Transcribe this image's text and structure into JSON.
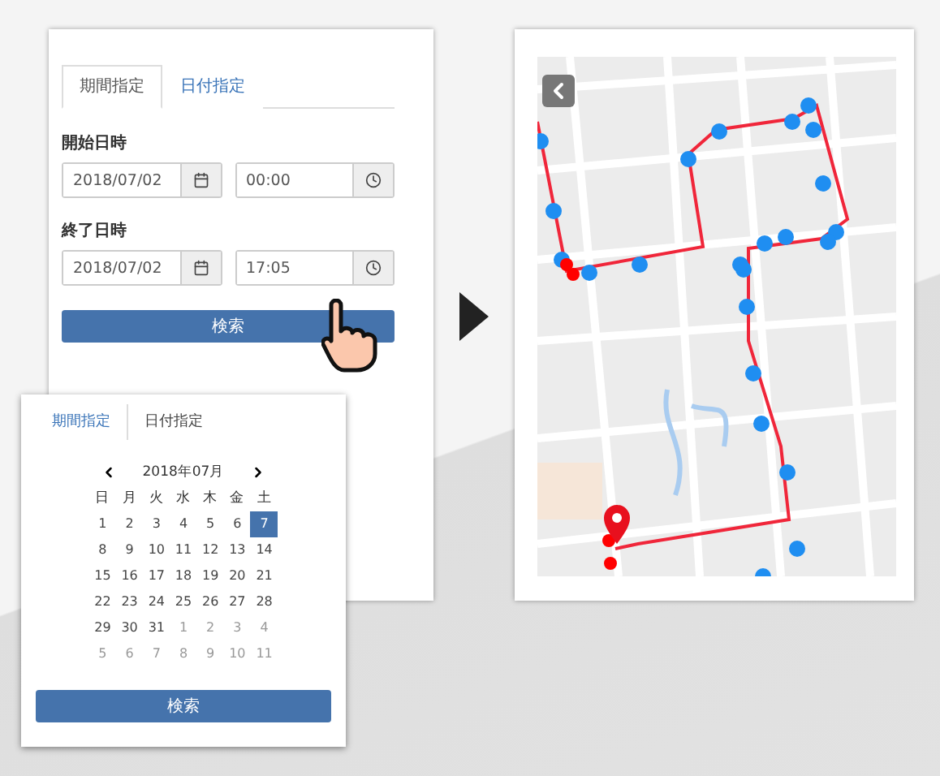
{
  "search_panel": {
    "tabs": [
      {
        "label": "期間指定",
        "selected": true
      },
      {
        "label": "日付指定",
        "selected": false
      }
    ],
    "fields": [
      {
        "label": "開始日時",
        "date": "2018/07/02",
        "time": "00:00"
      },
      {
        "label": "終了日時",
        "date": "2018/07/02",
        "time": "17:05"
      }
    ],
    "button": "検索"
  },
  "calendar_panel": {
    "tabs": [
      {
        "label": "期間指定",
        "selected": false
      },
      {
        "label": "日付指定",
        "selected": true
      }
    ],
    "month": "2018年07月",
    "weekdays": [
      "日",
      "月",
      "火",
      "水",
      "木",
      "金",
      "土"
    ],
    "days": [
      {
        "day": "1",
        "muted": false,
        "selected": false
      },
      {
        "day": "2",
        "muted": false,
        "selected": false
      },
      {
        "day": "3",
        "muted": false,
        "selected": false
      },
      {
        "day": "4",
        "muted": false,
        "selected": false
      },
      {
        "day": "5",
        "muted": false,
        "selected": false
      },
      {
        "day": "6",
        "muted": false,
        "selected": false
      },
      {
        "day": "7",
        "muted": false,
        "selected": true
      },
      {
        "day": "8",
        "muted": false,
        "selected": false
      },
      {
        "day": "9",
        "muted": false,
        "selected": false
      },
      {
        "day": "10",
        "muted": false,
        "selected": false
      },
      {
        "day": "11",
        "muted": false,
        "selected": false
      },
      {
        "day": "12",
        "muted": false,
        "selected": false
      },
      {
        "day": "13",
        "muted": false,
        "selected": false
      },
      {
        "day": "14",
        "muted": false,
        "selected": false
      },
      {
        "day": "15",
        "muted": false,
        "selected": false
      },
      {
        "day": "16",
        "muted": false,
        "selected": false
      },
      {
        "day": "17",
        "muted": false,
        "selected": false
      },
      {
        "day": "18",
        "muted": false,
        "selected": false
      },
      {
        "day": "19",
        "muted": false,
        "selected": false
      },
      {
        "day": "20",
        "muted": false,
        "selected": false
      },
      {
        "day": "21",
        "muted": false,
        "selected": false
      },
      {
        "day": "22",
        "muted": false,
        "selected": false
      },
      {
        "day": "23",
        "muted": false,
        "selected": false
      },
      {
        "day": "24",
        "muted": false,
        "selected": false
      },
      {
        "day": "25",
        "muted": false,
        "selected": false
      },
      {
        "day": "26",
        "muted": false,
        "selected": false
      },
      {
        "day": "27",
        "muted": false,
        "selected": false
      },
      {
        "day": "28",
        "muted": false,
        "selected": false
      },
      {
        "day": "29",
        "muted": false,
        "selected": false
      },
      {
        "day": "30",
        "muted": false,
        "selected": false
      },
      {
        "day": "31",
        "muted": false,
        "selected": false
      },
      {
        "day": "1",
        "muted": true,
        "selected": false
      },
      {
        "day": "2",
        "muted": true,
        "selected": false
      },
      {
        "day": "3",
        "muted": true,
        "selected": false
      },
      {
        "day": "4",
        "muted": true,
        "selected": false
      },
      {
        "day": "5",
        "muted": true,
        "selected": false
      },
      {
        "day": "6",
        "muted": true,
        "selected": false
      },
      {
        "day": "7",
        "muted": true,
        "selected": false
      },
      {
        "day": "8",
        "muted": true,
        "selected": false
      },
      {
        "day": "9",
        "muted": true,
        "selected": false
      },
      {
        "day": "10",
        "muted": true,
        "selected": false
      },
      {
        "day": "11",
        "muted": true,
        "selected": false
      }
    ],
    "button": "検索"
  }
}
